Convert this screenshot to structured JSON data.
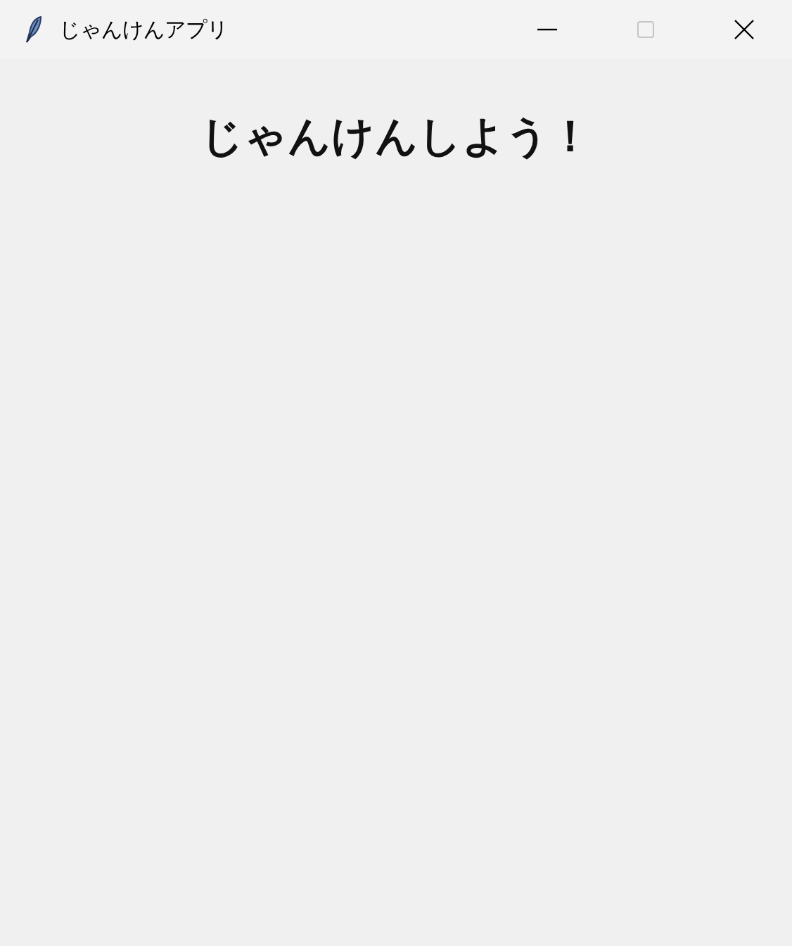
{
  "window": {
    "title": "じゃんけんアプリ",
    "controls": [
      {
        "kind": "minimize",
        "disabled": false
      },
      {
        "kind": "maximize",
        "disabled": true
      },
      {
        "kind": "close",
        "disabled": false
      }
    ]
  },
  "heading": "じゃんけんしよう！"
}
